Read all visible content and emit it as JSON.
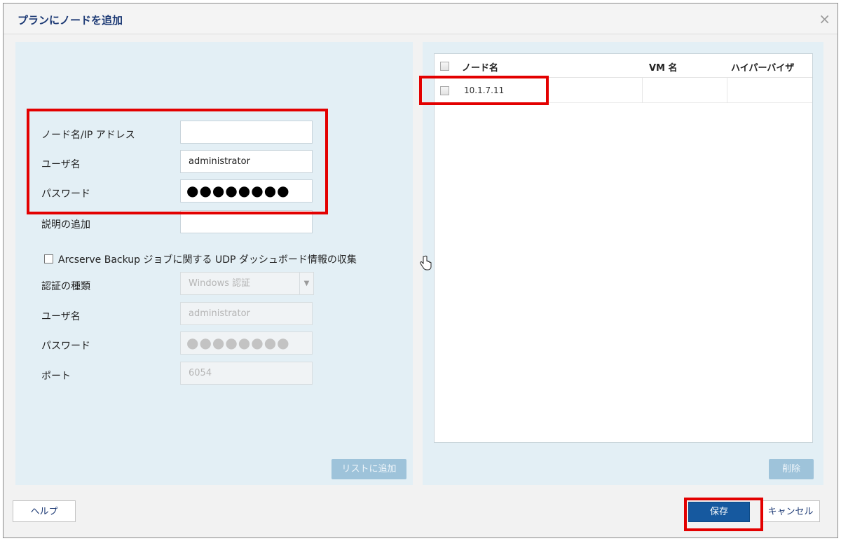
{
  "dialog": {
    "title": "プランにノードを追加",
    "close_glyph": "×"
  },
  "form": {
    "node_label": "ノード名/IP アドレス",
    "node_value": "",
    "user_label": "ユーザ名",
    "user_value": "administrator",
    "password_label": "パスワード",
    "password_mask": "●●●●●●●●",
    "desc_label": "説明の追加",
    "desc_value": "",
    "udp_checkbox_label": "Arcserve Backup ジョブに関する UDP ダッシュボード情報の収集",
    "udp_checked": false,
    "auth_type_label": "認証の種類",
    "auth_type_value": "Windows 認証",
    "udp_user_label": "ユーザ名",
    "udp_user_value": "administrator",
    "udp_password_label": "パスワード",
    "udp_password_mask": "●●●●●●●●",
    "port_label": "ポート",
    "port_value": "6054",
    "add_to_list_label": "リストに追加"
  },
  "grid": {
    "columns": [
      "ノード名",
      "VM 名",
      "ハイパーバイザ"
    ],
    "rows": [
      {
        "node": "10.1.7.11",
        "vm": "",
        "hypervisor": ""
      }
    ],
    "delete_label": "削除"
  },
  "footer": {
    "help_label": "ヘルプ",
    "save_label": "保存",
    "cancel_label": "キャンセル"
  },
  "colors": {
    "highlight": "#e30000",
    "primary": "#16599f",
    "panel_bg": "#e3eff5"
  }
}
